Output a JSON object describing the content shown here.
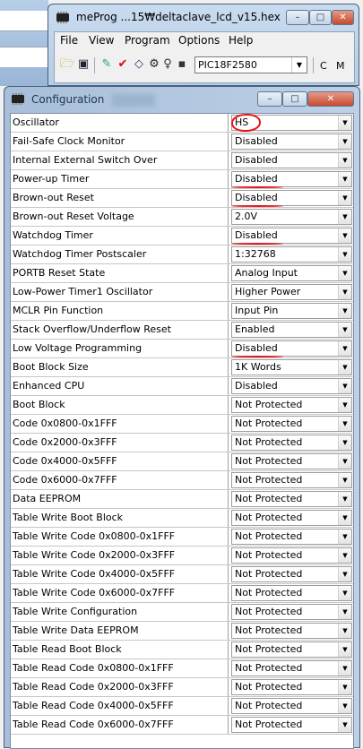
{
  "meprog": {
    "title": "meProg  ...15₩deltaclave_lcd_v15.hex",
    "window_buttons": [
      "–",
      "□",
      "✕"
    ],
    "menu": [
      "File",
      "View",
      "Program",
      "Options",
      "Help"
    ],
    "toolbar": {
      "icons": [
        "open-folder-icon",
        "save-disk-icon",
        "program-chip-icon",
        "verify-check-icon",
        "erase-eraser-icon",
        "bulb-icon",
        "read-chip-icon"
      ],
      "device": "PIC18F2580",
      "letters": [
        "C",
        "M"
      ]
    }
  },
  "config": {
    "title": "Configuration",
    "rows": [
      {
        "label": "Oscillator",
        "value": "HS"
      },
      {
        "label": "Fail-Safe Clock Monitor",
        "value": "Disabled"
      },
      {
        "label": "Internal External Switch Over",
        "value": "Disabled"
      },
      {
        "label": "Power-up Timer",
        "value": "Disabled"
      },
      {
        "label": "Brown-out Reset",
        "value": "Disabled"
      },
      {
        "label": "Brown-out Reset Voltage",
        "value": "2.0V"
      },
      {
        "label": "Watchdog Timer",
        "value": "Disabled"
      },
      {
        "label": "Watchdog Timer Postscaler",
        "value": "1:32768"
      },
      {
        "label": "PORTB Reset State",
        "value": "Analog Input"
      },
      {
        "label": "Low-Power Timer1 Oscillator",
        "value": "Higher Power"
      },
      {
        "label": "MCLR Pin Function",
        "value": "Input Pin"
      },
      {
        "label": "Stack Overflow/Underflow Reset",
        "value": "Enabled"
      },
      {
        "label": "Low Voltage Programming",
        "value": "Disabled"
      },
      {
        "label": "Boot Block Size",
        "value": "1K Words"
      },
      {
        "label": "Enhanced CPU",
        "value": "Disabled"
      },
      {
        "label": "Boot Block",
        "value": "Not Protected"
      },
      {
        "label": "Code 0x0800-0x1FFF",
        "value": "Not Protected"
      },
      {
        "label": "Code 0x2000-0x3FFF",
        "value": "Not Protected"
      },
      {
        "label": "Code 0x4000-0x5FFF",
        "value": "Not Protected"
      },
      {
        "label": "Code 0x6000-0x7FFF",
        "value": "Not Protected"
      },
      {
        "label": "Data EEPROM",
        "value": "Not Protected"
      },
      {
        "label": "Table Write Boot Block",
        "value": "Not Protected"
      },
      {
        "label": "Table Write Code 0x0800-0x1FFF",
        "value": "Not Protected"
      },
      {
        "label": "Table Write Code 0x2000-0x3FFF",
        "value": "Not Protected"
      },
      {
        "label": "Table Write Code 0x4000-0x5FFF",
        "value": "Not Protected"
      },
      {
        "label": "Table Write Code 0x6000-0x7FFF",
        "value": "Not Protected"
      },
      {
        "label": "Table Write Configuration",
        "value": "Not Protected"
      },
      {
        "label": "Table Write Data EEPROM",
        "value": "Not Protected"
      },
      {
        "label": "Table Read Boot Block",
        "value": "Not Protected"
      },
      {
        "label": "Table Read Code 0x0800-0x1FFF",
        "value": "Not Protected"
      },
      {
        "label": "Table Read Code 0x2000-0x3FFF",
        "value": "Not Protected"
      },
      {
        "label": "Table Read Code 0x4000-0x5FFF",
        "value": "Not Protected"
      },
      {
        "label": "Table Read Code 0x6000-0x7FFF",
        "value": "Not Protected"
      }
    ],
    "annotations": {
      "circled_row": 0,
      "underlined_rows": [
        3,
        4,
        6,
        12
      ],
      "color": "#e8141a"
    }
  }
}
